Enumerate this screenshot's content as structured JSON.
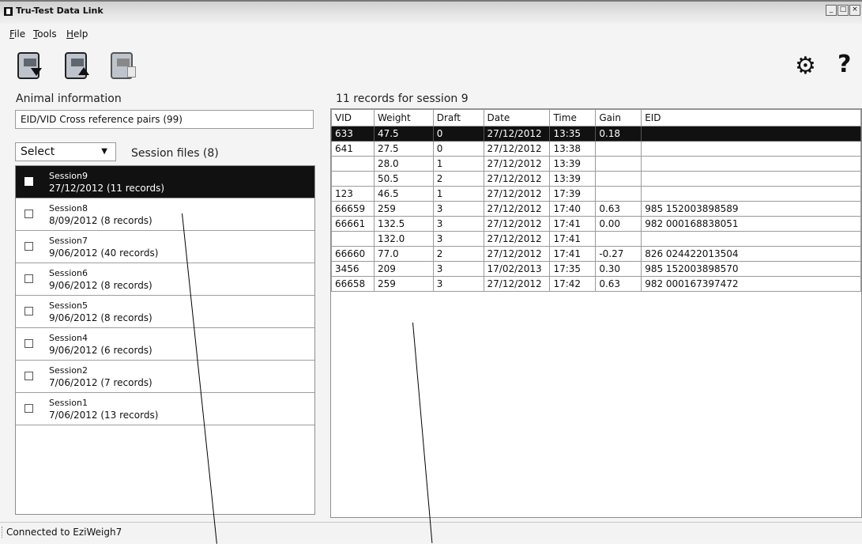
{
  "window": {
    "title": "Tru-Test Data Link",
    "buttons": [
      "_",
      "□",
      "×"
    ]
  },
  "menu": [
    {
      "label": "File",
      "underline": "F"
    },
    {
      "label": "Tools",
      "underline": "T"
    },
    {
      "label": "Help",
      "underline": "H"
    }
  ],
  "toolbar": {
    "icons": [
      "download-from-device-icon",
      "upload-to-device-icon",
      "delete-from-device-icon",
      "settings-gear-icon",
      "help-icon"
    ]
  },
  "left": {
    "heading": "Animal information",
    "eid_box": "EID/VID Cross reference pairs (99)",
    "select_value": "Select",
    "session_count": "Session files (8)",
    "sessions": [
      {
        "name": "Session9",
        "detail": "27/12/2012  (11 records)",
        "selected": true
      },
      {
        "name": "Session8",
        "detail": "8/09/2012  (8 records)",
        "selected": false
      },
      {
        "name": "Session7",
        "detail": "9/06/2012  (40 records)",
        "selected": false
      },
      {
        "name": "Session6",
        "detail": "9/06/2012  (8 records)",
        "selected": false
      },
      {
        "name": "Session5",
        "detail": "9/06/2012  (8 records)",
        "selected": false
      },
      {
        "name": "Session4",
        "detail": "9/06/2012  (6 records)",
        "selected": false
      },
      {
        "name": "Session2",
        "detail": "7/06/2012  (7 records)",
        "selected": false
      },
      {
        "name": "Session1",
        "detail": "7/06/2012  (13 records)",
        "selected": false
      }
    ]
  },
  "records": {
    "heading": "11 records for session 9",
    "columns": [
      "VID",
      "Weight",
      "Draft",
      "Date",
      "Time",
      "Gain",
      "EID"
    ],
    "rows": [
      [
        "633",
        "47.5",
        "0",
        "27/12/2012",
        "13:35",
        "0.18",
        ""
      ],
      [
        "641",
        "27.5",
        "0",
        "27/12/2012",
        "13:38",
        "",
        ""
      ],
      [
        "",
        "28.0",
        "1",
        "27/12/2012",
        "13:39",
        "",
        ""
      ],
      [
        "",
        "50.5",
        "2",
        "27/12/2012",
        "13:39",
        "",
        ""
      ],
      [
        "123",
        "46.5",
        "1",
        "27/12/2012",
        "17:39",
        "",
        ""
      ],
      [
        "66659",
        "259",
        "3",
        "27/12/2012",
        "17:40",
        "0.63",
        "985 152003898589"
      ],
      [
        "66661",
        "132.5",
        "3",
        "27/12/2012",
        "17:41",
        "0.00",
        "982 000168838051"
      ],
      [
        "",
        "132.0",
        "3",
        "27/12/2012",
        "17:41",
        "",
        ""
      ],
      [
        "66660",
        "77.0",
        "2",
        "27/12/2012",
        "17:41",
        "-0.27",
        "826 024422013504"
      ],
      [
        "3456",
        "209",
        "3",
        "17/02/2013",
        "17:35",
        "0.30",
        "985 152003898570"
      ],
      [
        "66658",
        "259",
        "3",
        "27/12/2012",
        "17:42",
        "0.63",
        "982 000167397472"
      ]
    ],
    "selected_row": 0
  },
  "status": {
    "text": "Connected to EziWeigh7"
  }
}
